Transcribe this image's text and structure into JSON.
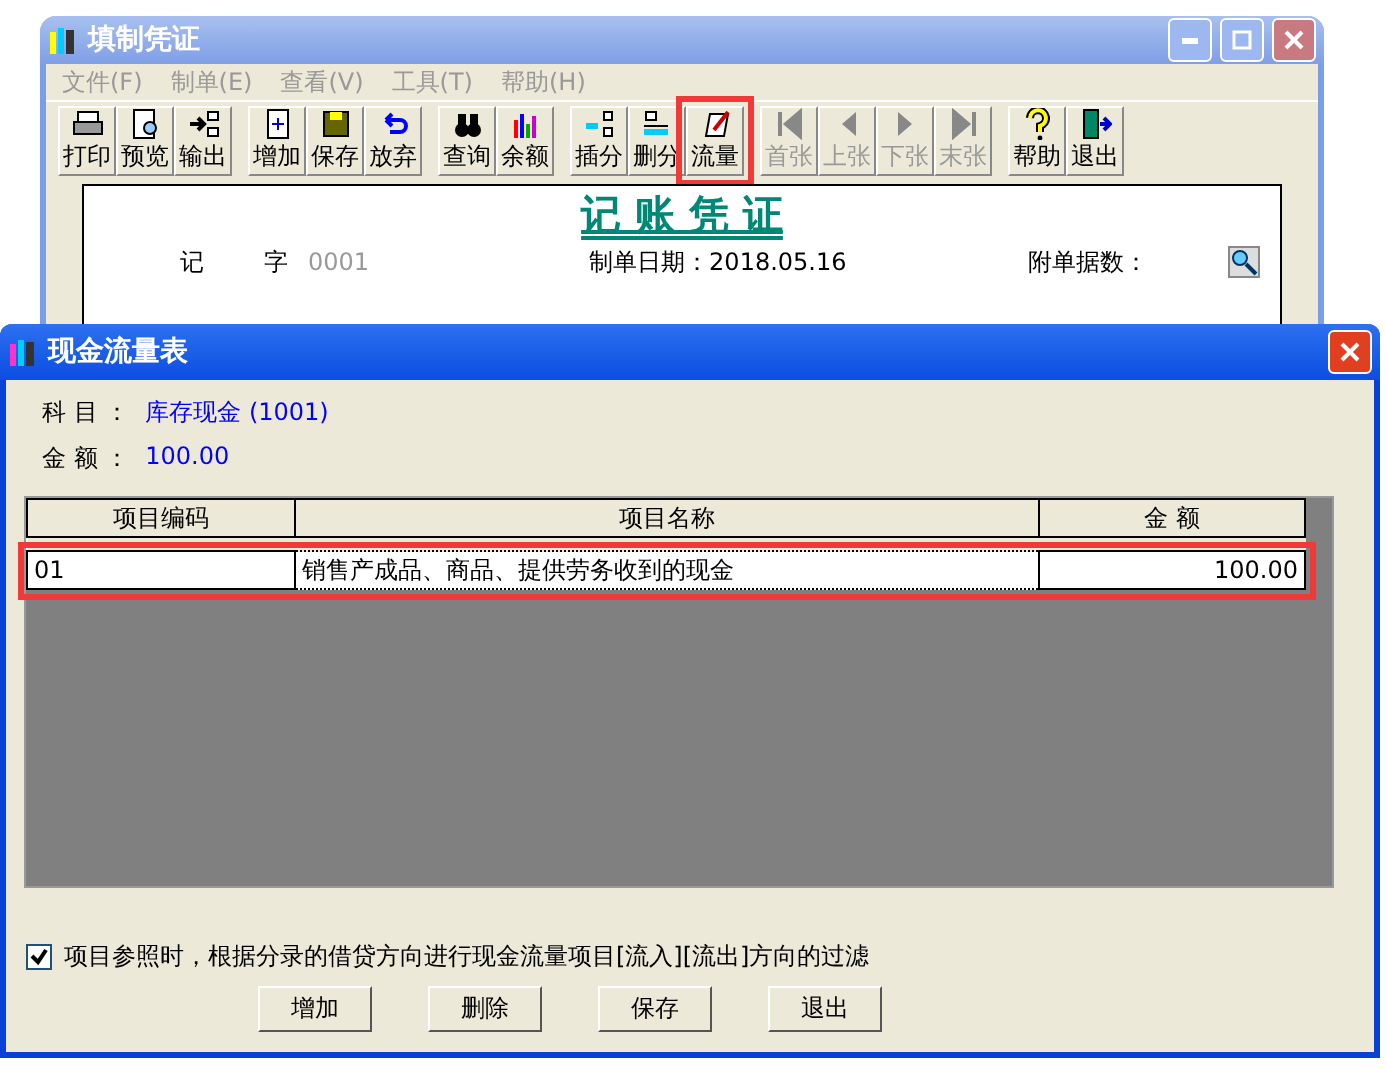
{
  "main_window": {
    "title": "填制凭证",
    "menu": [
      "文件(F)",
      "制单(E)",
      "查看(V)",
      "工具(T)",
      "帮助(H)"
    ],
    "toolbar_groups": [
      [
        {
          "label": "打印",
          "disabled": false,
          "highlighted": false
        },
        {
          "label": "预览",
          "disabled": false,
          "highlighted": false
        },
        {
          "label": "输出",
          "disabled": false,
          "highlighted": false
        }
      ],
      [
        {
          "label": "增加",
          "disabled": false,
          "highlighted": false
        },
        {
          "label": "保存",
          "disabled": false,
          "highlighted": false
        },
        {
          "label": "放弃",
          "disabled": false,
          "highlighted": false
        }
      ],
      [
        {
          "label": "查询",
          "disabled": false,
          "highlighted": false
        },
        {
          "label": "余额",
          "disabled": false,
          "highlighted": false
        }
      ],
      [
        {
          "label": "插分",
          "disabled": false,
          "highlighted": false
        },
        {
          "label": "删分",
          "disabled": false,
          "highlighted": false
        },
        {
          "label": "流量",
          "disabled": false,
          "highlighted": true
        }
      ],
      [
        {
          "label": "首张",
          "disabled": true,
          "highlighted": false
        },
        {
          "label": "上张",
          "disabled": true,
          "highlighted": false
        },
        {
          "label": "下张",
          "disabled": true,
          "highlighted": false
        },
        {
          "label": "末张",
          "disabled": true,
          "highlighted": false
        }
      ],
      [
        {
          "label": "帮助",
          "disabled": false,
          "highlighted": false
        },
        {
          "label": "退出",
          "disabled": false,
          "highlighted": false
        }
      ]
    ],
    "voucher": {
      "title": "记 账 凭 证",
      "type": "记",
      "type_suffix": "字",
      "number": "0001",
      "date_label": "制单日期：2018.05.16",
      "attachments_label": "附单据数："
    }
  },
  "dialog": {
    "title": "现金流量表",
    "subject_label": "科 目 ：",
    "subject_value": "库存现金 (1001)",
    "amount_label": "金 额 ：",
    "amount_value": "100.00",
    "table": {
      "columns": [
        "项目编码",
        "项目名称",
        "金 额"
      ],
      "rows": [
        {
          "code": "01",
          "name": "销售产成品、商品、提供劳务收到的现金",
          "amount": "100.00",
          "highlighted": true
        }
      ]
    },
    "filter_checkbox": {
      "label": "项目参照时，根据分录的借贷方向进行现金流量项目[流入][流出]方向的过滤",
      "checked": true
    },
    "buttons": [
      "增加",
      "删除",
      "保存",
      "退出"
    ]
  }
}
